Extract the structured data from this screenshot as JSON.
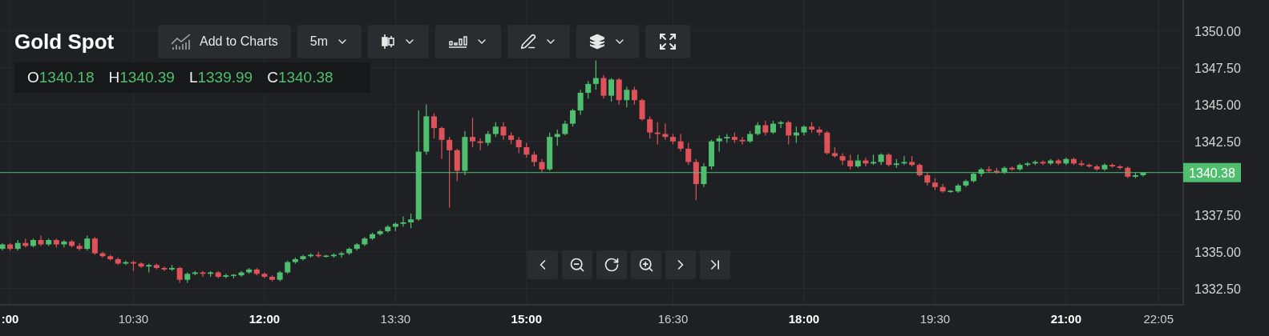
{
  "header": {
    "title": "Gold Spot"
  },
  "toolbar": [
    {
      "kind": "add",
      "label": "Add to Charts"
    },
    {
      "kind": "interval",
      "label": "5m"
    },
    {
      "kind": "candles"
    },
    {
      "kind": "indicators"
    },
    {
      "kind": "draw"
    },
    {
      "kind": "layers"
    },
    {
      "kind": "fullscreen"
    }
  ],
  "ohlc": [
    {
      "key": "O",
      "value": "1340.18"
    },
    {
      "key": "H",
      "value": "1340.39"
    },
    {
      "key": "L",
      "value": "1339.99"
    },
    {
      "key": "C",
      "value": "1340.38"
    }
  ],
  "time_axis": {
    "major": [
      true,
      false,
      true,
      false,
      true,
      false,
      true,
      false,
      true,
      false
    ]
  },
  "chart_data": {
    "type": "candlestick",
    "grid": true,
    "ylim": [
      1331.4,
      1352.1
    ],
    "yticks": [
      {
        "value": 1332.5,
        "label": "1332.50"
      },
      {
        "value": 1335,
        "label": "1335.00"
      },
      {
        "value": 1337.5,
        "label": "1337.50"
      },
      {
        "value": 1342.5,
        "label": "1342.50"
      },
      {
        "value": 1345,
        "label": "1345.00"
      },
      {
        "value": 1347.5,
        "label": "1347.50"
      },
      {
        "value": 1350,
        "label": "1350.00"
      }
    ],
    "ref_lines": [
      {
        "axis": "y",
        "value": 1340.38,
        "label": "1340.38",
        "color": "#4fbf6f"
      }
    ],
    "categories": [
      null,
      ":00",
      null,
      null,
      null,
      null,
      null,
      null,
      null,
      null,
      null,
      null,
      null,
      null,
      null,
      null,
      null,
      "10:30",
      null,
      null,
      null,
      null,
      null,
      null,
      null,
      null,
      null,
      null,
      null,
      null,
      null,
      null,
      null,
      null,
      "12:00",
      null,
      null,
      null,
      null,
      null,
      null,
      null,
      null,
      null,
      null,
      null,
      null,
      null,
      null,
      null,
      null,
      "13:30",
      null,
      null,
      null,
      null,
      null,
      null,
      null,
      null,
      null,
      null,
      null,
      null,
      null,
      null,
      null,
      null,
      "15:00",
      null,
      null,
      null,
      null,
      null,
      null,
      null,
      null,
      null,
      null,
      null,
      null,
      null,
      null,
      null,
      null,
      null,
      null,
      "16:30",
      null,
      null,
      null,
      null,
      null,
      null,
      null,
      null,
      null,
      null,
      null,
      null,
      null,
      null,
      null,
      null,
      "18:00",
      null,
      null,
      null,
      null,
      null,
      null,
      null,
      null,
      null,
      null,
      null,
      null,
      null,
      null,
      null,
      null,
      "19:30",
      null,
      null,
      null,
      null,
      null,
      null,
      null,
      null,
      null,
      null,
      null,
      null,
      null,
      null,
      null,
      null,
      "21:00",
      null,
      null,
      null,
      null,
      null,
      null,
      null,
      null,
      null,
      null,
      null,
      "22:05"
    ],
    "ohlc": [
      [
        1335.2,
        1335.6,
        1335.1,
        1335.5
      ],
      [
        1335.5,
        1335.6,
        1335.1,
        1335.2
      ],
      [
        1335.2,
        1335.8,
        1335.1,
        1335.6
      ],
      [
        1335.6,
        1335.9,
        1335.3,
        1335.4
      ],
      [
        1335.4,
        1335.9,
        1335.3,
        1335.8
      ],
      [
        1335.8,
        1336.1,
        1335.4,
        1335.5
      ],
      [
        1335.5,
        1335.9,
        1335.4,
        1335.8
      ],
      [
        1335.8,
        1335.9,
        1335.3,
        1335.5
      ],
      [
        1335.5,
        1335.8,
        1335.3,
        1335.7
      ],
      [
        1335.7,
        1335.8,
        1335.3,
        1335.4
      ],
      [
        1335.4,
        1335.6,
        1335.1,
        1335.2
      ],
      [
        1335.2,
        1336.1,
        1335.1,
        1335.9
      ],
      [
        1335.9,
        1336.0,
        1334.8,
        1334.9
      ],
      [
        1334.9,
        1335.0,
        1334.6,
        1334.7
      ],
      [
        1334.7,
        1334.8,
        1334.4,
        1334.5
      ],
      [
        1334.5,
        1334.6,
        1334.1,
        1334.2
      ],
      [
        1334.2,
        1334.4,
        1334.1,
        1334.3
      ],
      [
        1334.3,
        1334.4,
        1333.7,
        1334.2
      ],
      [
        1334.2,
        1334.3,
        1333.9,
        1334.0
      ],
      [
        1334.0,
        1334.2,
        1333.6,
        1334.1
      ],
      [
        1334.1,
        1334.2,
        1333.8,
        1333.9
      ],
      [
        1333.9,
        1334.0,
        1333.7,
        1333.8
      ],
      [
        1333.8,
        1334.1,
        1333.7,
        1333.9
      ],
      [
        1333.9,
        1334.0,
        1332.9,
        1333.1
      ],
      [
        1333.1,
        1333.6,
        1332.9,
        1333.5
      ],
      [
        1333.5,
        1333.7,
        1333.4,
        1333.6
      ],
      [
        1333.6,
        1333.7,
        1333.3,
        1333.5
      ],
      [
        1333.5,
        1333.7,
        1333.3,
        1333.6
      ],
      [
        1333.6,
        1333.7,
        1333.2,
        1333.3
      ],
      [
        1333.3,
        1333.5,
        1333.2,
        1333.4
      ],
      [
        1333.4,
        1333.5,
        1333.2,
        1333.4
      ],
      [
        1333.4,
        1333.7,
        1333.3,
        1333.6
      ],
      [
        1333.6,
        1333.9,
        1333.5,
        1333.8
      ],
      [
        1333.8,
        1333.9,
        1333.4,
        1333.5
      ],
      [
        1333.5,
        1333.6,
        1333.2,
        1333.3
      ],
      [
        1333.3,
        1333.4,
        1333.0,
        1333.1
      ],
      [
        1333.1,
        1333.7,
        1333.0,
        1333.6
      ],
      [
        1333.6,
        1334.4,
        1333.5,
        1334.3
      ],
      [
        1334.3,
        1334.6,
        1334.2,
        1334.5
      ],
      [
        1334.5,
        1334.8,
        1334.4,
        1334.7
      ],
      [
        1334.7,
        1334.9,
        1334.6,
        1334.8
      ],
      [
        1334.8,
        1335.0,
        1334.6,
        1334.7
      ],
      [
        1334.7,
        1334.8,
        1334.6,
        1334.7
      ],
      [
        1334.7,
        1334.9,
        1334.6,
        1334.8
      ],
      [
        1334.8,
        1335.0,
        1334.6,
        1334.9
      ],
      [
        1334.9,
        1335.3,
        1334.8,
        1335.2
      ],
      [
        1335.2,
        1335.6,
        1335.1,
        1335.5
      ],
      [
        1335.5,
        1336.0,
        1335.4,
        1335.9
      ],
      [
        1335.9,
        1336.3,
        1335.8,
        1336.2
      ],
      [
        1336.2,
        1336.5,
        1336.1,
        1336.4
      ],
      [
        1336.4,
        1336.8,
        1336.3,
        1336.7
      ],
      [
        1336.7,
        1337.0,
        1336.4,
        1336.9
      ],
      [
        1336.9,
        1337.4,
        1336.7,
        1337.0
      ],
      [
        1337.0,
        1337.6,
        1336.6,
        1337.2
      ],
      [
        1337.2,
        1344.6,
        1337.1,
        1341.8
      ],
      [
        1341.8,
        1345.0,
        1341.6,
        1344.2
      ],
      [
        1344.2,
        1344.4,
        1342.7,
        1343.4
      ],
      [
        1343.4,
        1343.5,
        1341.3,
        1342.6
      ],
      [
        1342.6,
        1342.8,
        1338.0,
        1341.9
      ],
      [
        1341.9,
        1342.0,
        1339.8,
        1340.5
      ],
      [
        1340.5,
        1343.2,
        1340.2,
        1342.8
      ],
      [
        1342.8,
        1344.1,
        1342.1,
        1342.5
      ],
      [
        1342.5,
        1342.7,
        1341.9,
        1342.4
      ],
      [
        1342.4,
        1343.2,
        1342.2,
        1343.0
      ],
      [
        1343.0,
        1343.8,
        1342.8,
        1343.5
      ],
      [
        1343.5,
        1343.8,
        1342.6,
        1342.9
      ],
      [
        1342.9,
        1343.1,
        1342.3,
        1342.6
      ],
      [
        1342.6,
        1342.8,
        1341.7,
        1342.1
      ],
      [
        1342.1,
        1342.4,
        1341.4,
        1341.6
      ],
      [
        1341.6,
        1341.8,
        1340.8,
        1341.1
      ],
      [
        1341.1,
        1341.3,
        1340.4,
        1340.6
      ],
      [
        1340.6,
        1343.1,
        1340.5,
        1342.8
      ],
      [
        1342.8,
        1343.3,
        1342.2,
        1343.0
      ],
      [
        1343.0,
        1343.9,
        1342.9,
        1343.7
      ],
      [
        1343.7,
        1344.7,
        1343.5,
        1344.6
      ],
      [
        1344.6,
        1346.0,
        1344.3,
        1345.8
      ],
      [
        1345.8,
        1346.6,
        1345.4,
        1346.4
      ],
      [
        1346.4,
        1348.0,
        1346.0,
        1346.8
      ],
      [
        1346.8,
        1347.0,
        1345.4,
        1345.6
      ],
      [
        1345.6,
        1346.8,
        1345.2,
        1346.7
      ],
      [
        1346.7,
        1346.8,
        1345.0,
        1345.3
      ],
      [
        1345.3,
        1346.2,
        1344.8,
        1346.0
      ],
      [
        1346.0,
        1346.2,
        1345.0,
        1345.3
      ],
      [
        1345.3,
        1345.4,
        1343.9,
        1344.0
      ],
      [
        1344.0,
        1344.2,
        1342.7,
        1343.1
      ],
      [
        1343.1,
        1343.8,
        1342.3,
        1343.0
      ],
      [
        1343.0,
        1343.7,
        1342.6,
        1342.8
      ],
      [
        1342.8,
        1343.0,
        1342.3,
        1342.5
      ],
      [
        1342.5,
        1343.0,
        1341.8,
        1342.0
      ],
      [
        1342.0,
        1342.4,
        1340.9,
        1341.1
      ],
      [
        1341.1,
        1341.3,
        1338.5,
        1339.6
      ],
      [
        1339.6,
        1341.0,
        1339.4,
        1340.8
      ],
      [
        1340.8,
        1342.6,
        1340.6,
        1342.5
      ],
      [
        1342.5,
        1342.9,
        1341.8,
        1342.7
      ],
      [
        1342.7,
        1343.0,
        1342.4,
        1342.8
      ],
      [
        1342.8,
        1343.1,
        1342.4,
        1342.6
      ],
      [
        1342.6,
        1342.8,
        1342.3,
        1342.5
      ],
      [
        1342.5,
        1343.2,
        1342.4,
        1343.0
      ],
      [
        1343.0,
        1343.8,
        1342.9,
        1343.6
      ],
      [
        1343.6,
        1343.9,
        1342.9,
        1343.1
      ],
      [
        1343.1,
        1343.9,
        1343.0,
        1343.7
      ],
      [
        1343.7,
        1343.9,
        1343.4,
        1343.8
      ],
      [
        1343.8,
        1343.9,
        1342.3,
        1342.9
      ],
      [
        1342.9,
        1343.5,
        1342.4,
        1343.1
      ],
      [
        1343.1,
        1343.6,
        1342.9,
        1343.5
      ],
      [
        1343.5,
        1343.8,
        1343.1,
        1343.3
      ],
      [
        1343.3,
        1343.5,
        1342.9,
        1343.1
      ],
      [
        1343.1,
        1343.2,
        1341.6,
        1341.7
      ],
      [
        1341.7,
        1342.1,
        1341.4,
        1341.5
      ],
      [
        1341.5,
        1341.7,
        1340.9,
        1341.2
      ],
      [
        1341.2,
        1341.6,
        1340.6,
        1340.8
      ],
      [
        1340.8,
        1341.6,
        1340.7,
        1341.2
      ],
      [
        1341.2,
        1341.4,
        1340.8,
        1341.0
      ],
      [
        1341.0,
        1341.6,
        1340.9,
        1341.1
      ],
      [
        1341.1,
        1341.7,
        1340.9,
        1341.6
      ],
      [
        1341.6,
        1341.7,
        1340.8,
        1340.9
      ],
      [
        1340.9,
        1341.3,
        1340.7,
        1341.0
      ],
      [
        1341.0,
        1341.5,
        1340.9,
        1341.1
      ],
      [
        1341.1,
        1341.5,
        1340.8,
        1340.9
      ],
      [
        1340.9,
        1341.0,
        1340.1,
        1340.2
      ],
      [
        1340.2,
        1340.4,
        1339.5,
        1339.7
      ],
      [
        1339.7,
        1340.0,
        1339.2,
        1339.4
      ],
      [
        1339.4,
        1339.6,
        1339.0,
        1339.1
      ],
      [
        1339.1,
        1339.2,
        1339.0,
        1339.1
      ],
      [
        1339.1,
        1339.6,
        1339.0,
        1339.5
      ],
      [
        1339.5,
        1339.9,
        1339.4,
        1339.8
      ],
      [
        1339.8,
        1340.4,
        1339.7,
        1340.3
      ],
      [
        1340.3,
        1340.7,
        1340.1,
        1340.6
      ],
      [
        1340.6,
        1340.8,
        1340.4,
        1340.5
      ],
      [
        1340.5,
        1340.7,
        1340.3,
        1340.4
      ],
      [
        1340.4,
        1340.8,
        1340.3,
        1340.7
      ],
      [
        1340.7,
        1340.8,
        1340.5,
        1340.6
      ],
      [
        1340.6,
        1341.0,
        1340.5,
        1340.9
      ],
      [
        1340.9,
        1341.1,
        1340.8,
        1341.0
      ],
      [
        1341.0,
        1341.2,
        1340.9,
        1341.1
      ],
      [
        1341.1,
        1341.2,
        1340.9,
        1341.0
      ],
      [
        1341.0,
        1341.3,
        1340.9,
        1341.2
      ],
      [
        1341.2,
        1341.3,
        1340.9,
        1341.0
      ],
      [
        1341.0,
        1341.4,
        1340.9,
        1341.3
      ],
      [
        1341.3,
        1341.4,
        1340.9,
        1341.0
      ],
      [
        1341.0,
        1341.2,
        1340.8,
        1340.9
      ],
      [
        1340.9,
        1341.0,
        1340.7,
        1340.8
      ],
      [
        1340.8,
        1340.9,
        1340.5,
        1340.6
      ],
      [
        1340.6,
        1341.0,
        1340.5,
        1340.9
      ],
      [
        1340.9,
        1341.0,
        1340.7,
        1340.8
      ],
      [
        1340.8,
        1340.9,
        1340.6,
        1340.7
      ],
      [
        1340.7,
        1340.8,
        1340.0,
        1340.1
      ],
      [
        1340.1,
        1340.4,
        1340.0,
        1340.2
      ],
      [
        1340.2,
        1340.4,
        1340.1,
        1340.38
      ],
      null,
      null
    ]
  },
  "navigation": [
    {
      "kind": "back"
    },
    {
      "kind": "zoom_out"
    },
    {
      "kind": "reset"
    },
    {
      "kind": "zoom_in"
    },
    {
      "kind": "forward"
    },
    {
      "kind": "latest"
    }
  ]
}
